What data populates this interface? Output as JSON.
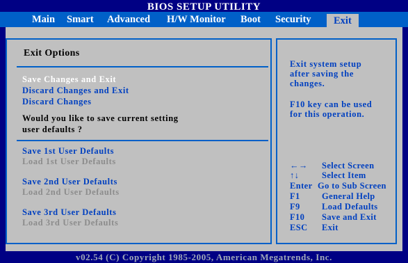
{
  "title": "BIOS SETUP UTILITY",
  "menu": {
    "items": [
      "Main",
      "Smart",
      "Advanced",
      "H/W Monitor",
      "Boot",
      "Security",
      "Exit"
    ],
    "active": "Exit"
  },
  "panel": {
    "heading": "Exit Options",
    "options": [
      {
        "label": "Save Changes and Exit",
        "state": "selected"
      },
      {
        "label": "Discard Changes and Exit",
        "state": "enabled"
      },
      {
        "label": "Discard Changes",
        "state": "enabled"
      }
    ],
    "prompt_line1": "Would you like to save current setting",
    "prompt_line2": "user defaults ?",
    "user_defaults": [
      {
        "label": "Save 1st User Defaults",
        "state": "enabled"
      },
      {
        "label": "Load 1st User Defaults",
        "state": "disabled"
      },
      {
        "label": "Save 2nd User Defaults",
        "state": "enabled"
      },
      {
        "label": "Load 2nd User Defaults",
        "state": "disabled"
      },
      {
        "label": "Save 3rd User Defaults",
        "state": "enabled"
      },
      {
        "label": "Load 3rd User Defaults",
        "state": "disabled"
      }
    ]
  },
  "help": {
    "description": [
      "Exit system setup",
      "after saving the",
      "changes."
    ],
    "note": [
      "F10 key can be used",
      "for this operation."
    ],
    "keys": [
      {
        "key": "←→",
        "action": "Select Screen"
      },
      {
        "key": "↑↓",
        "action": "Select Item"
      },
      {
        "key": "Enter",
        "action": "Go to Sub Screen"
      },
      {
        "key": "F1",
        "action": "General Help"
      },
      {
        "key": "F9",
        "action": "Load Defaults"
      },
      {
        "key": "F10",
        "action": "Save and Exit"
      },
      {
        "key": "ESC",
        "action": "Exit"
      }
    ]
  },
  "footer": "v02.54 (C) Copyright 1985-2005, American Megatrends, Inc.",
  "colors": {
    "background": "#000084",
    "menubar": "#0060c8",
    "panel": "#c0c0c0",
    "highlight_text": "#ffffff",
    "option_text": "#0040c0",
    "disabled_text": "#8c8c8c"
  }
}
